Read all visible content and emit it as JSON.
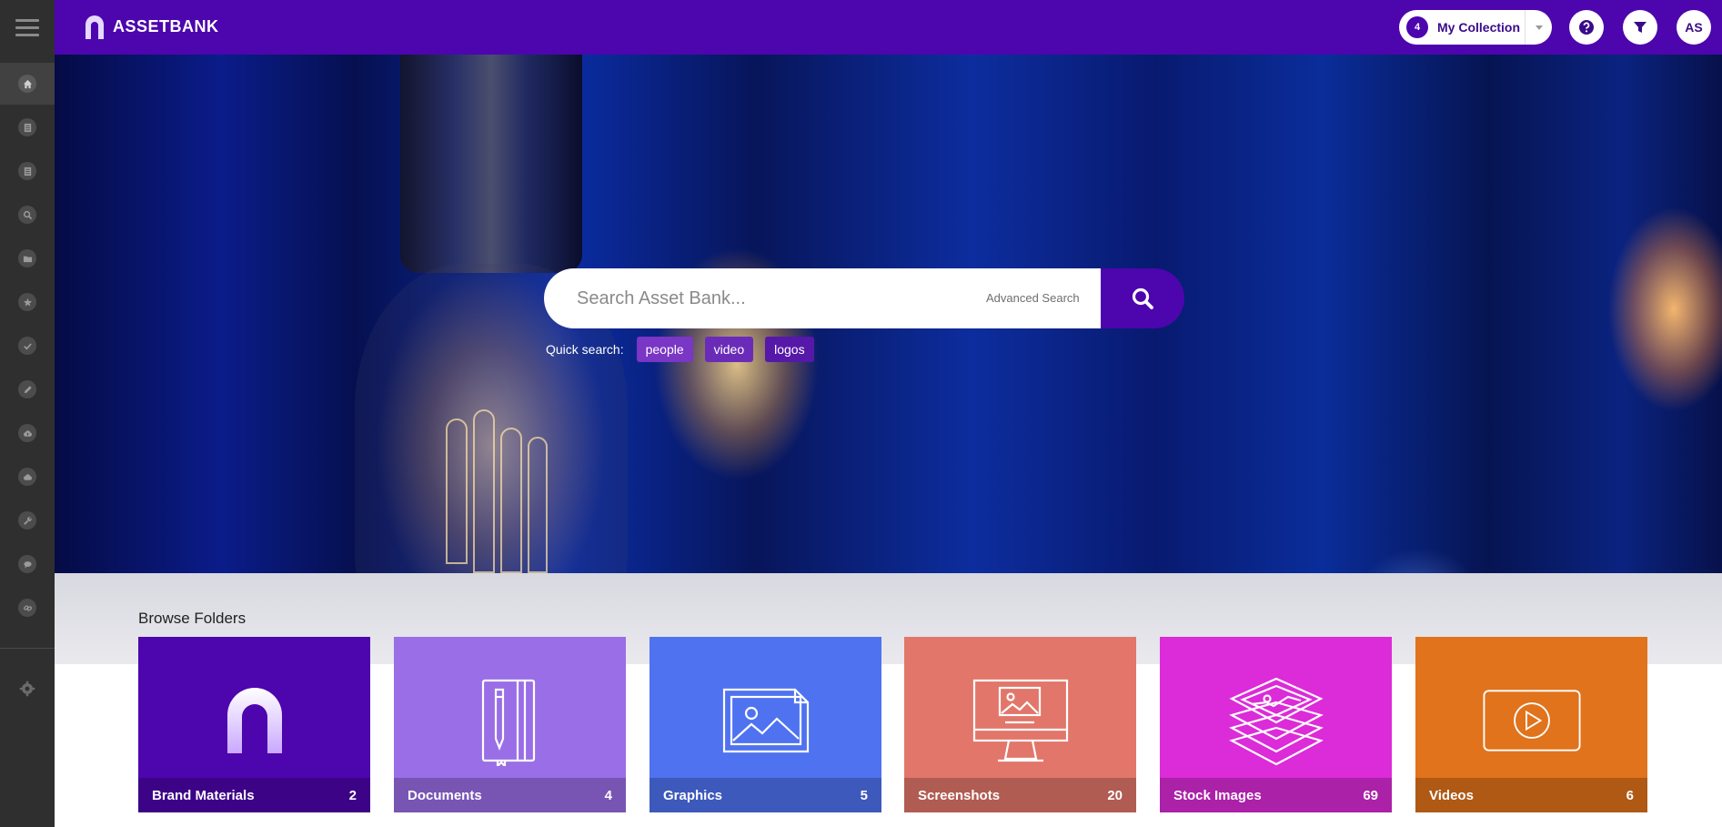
{
  "app": {
    "name": "ASSETBANK"
  },
  "sidebar": {
    "items": [
      {
        "name": "home",
        "icon": "home-icon",
        "active": true
      },
      {
        "name": "list-1",
        "icon": "document-list-icon"
      },
      {
        "name": "list-2",
        "icon": "document-list-icon"
      },
      {
        "name": "search",
        "icon": "search-icon"
      },
      {
        "name": "folder",
        "icon": "folder-icon"
      },
      {
        "name": "favorites",
        "icon": "star-icon"
      },
      {
        "name": "approvals",
        "icon": "check-icon"
      },
      {
        "name": "edit",
        "icon": "pencil-icon"
      },
      {
        "name": "upload",
        "icon": "cloud-upload-icon"
      },
      {
        "name": "cloud",
        "icon": "cloud-icon"
      },
      {
        "name": "tools",
        "icon": "wrench-icon"
      },
      {
        "name": "comments",
        "icon": "chat-icon"
      },
      {
        "name": "links",
        "icon": "link-icon"
      }
    ],
    "settings_icon": "gear-icon"
  },
  "header": {
    "collection": {
      "count": "4",
      "label": "My Collection"
    },
    "help_icon": "question-icon",
    "filter_icon": "filter-icon",
    "avatar": "AS",
    "color": "#4d05ae"
  },
  "search": {
    "placeholder": "Search Asset Bank...",
    "advanced_label": "Advanced Search",
    "quick_label": "Quick search:",
    "quick_tags": [
      "people",
      "video",
      "logos"
    ]
  },
  "browse": {
    "title": "Browse Folders",
    "folders": [
      {
        "label": "Brand Materials",
        "count": "2",
        "color": "#4d05ae",
        "icon": "assetbank-logo-icon"
      },
      {
        "label": "Documents",
        "count": "4",
        "color": "#9a6ee6",
        "icon": "notebook-pencil-icon"
      },
      {
        "label": "Graphics",
        "count": "5",
        "color": "#4f72f0",
        "icon": "image-file-icon"
      },
      {
        "label": "Screenshots",
        "count": "20",
        "color": "#e2766a",
        "icon": "monitor-image-icon"
      },
      {
        "label": "Stock Images",
        "count": "69",
        "color": "#dc2bd8",
        "icon": "layered-images-icon"
      },
      {
        "label": "Videos",
        "count": "6",
        "color": "#e0731c",
        "icon": "video-play-icon"
      }
    ]
  }
}
